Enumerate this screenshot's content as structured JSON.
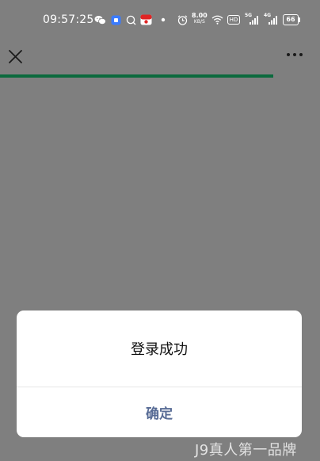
{
  "status_bar": {
    "time": "09:57:25",
    "net_speed_value": "8.00",
    "net_speed_unit": "KB/S",
    "hd_badge": "HD",
    "signal_1_label": "5G",
    "signal_2_label": "4G",
    "battery_level": "66",
    "icons": [
      "wechat-icon",
      "app-blue-icon",
      "chat-bubble-icon",
      "red-app-icon",
      "dot-icon",
      "alarm-icon",
      "wifi-icon",
      "signal-icon",
      "signal-icon",
      "battery-icon"
    ]
  },
  "nav": {
    "close_icon": "close-icon",
    "more_icon": "more-dots-icon",
    "progress_fraction": 0.855,
    "progress_color": "#0b6a3d"
  },
  "dialog": {
    "message": "登录成功",
    "confirm_label": "确定",
    "confirm_color": "#576b95"
  },
  "watermark": "J9真人第一品牌"
}
